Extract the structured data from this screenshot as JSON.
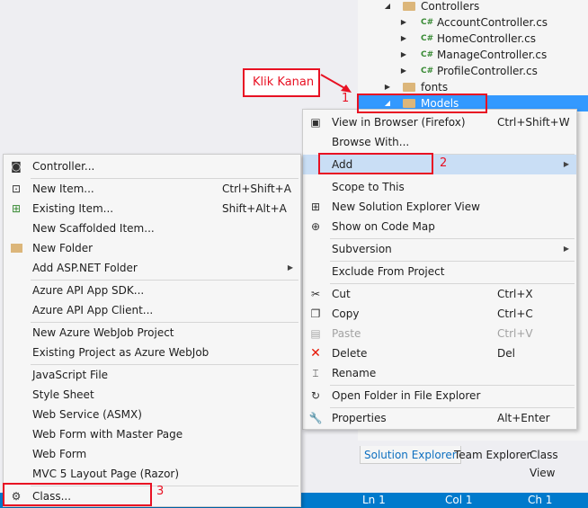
{
  "tree": {
    "items": [
      {
        "label": "Controllers",
        "kind": "folder",
        "expander": "open"
      },
      {
        "label": "AccountController.cs",
        "kind": "cs",
        "expander": "closed"
      },
      {
        "label": "HomeController.cs",
        "kind": "cs",
        "expander": "closed"
      },
      {
        "label": "ManageController.cs",
        "kind": "cs",
        "expander": "closed"
      },
      {
        "label": "ProfileController.cs",
        "kind": "cs",
        "expander": "closed"
      },
      {
        "label": "fonts",
        "kind": "folder",
        "expander": "closed"
      },
      {
        "label": "Models",
        "kind": "folder",
        "expander": "open",
        "selected": true
      }
    ],
    "cs_badge": "C#"
  },
  "context_menu": {
    "items": [
      {
        "label": "View in Browser (Firefox)",
        "shortcut": "Ctrl+Shift+W",
        "icon": "browser-icon"
      },
      {
        "label": "Browse With...",
        "shortcut": ""
      },
      {
        "label": "Add",
        "shortcut": "",
        "submenu": true,
        "highlighted": true
      },
      {
        "label": "Scope to This",
        "shortcut": ""
      },
      {
        "label": "New Solution Explorer View",
        "shortcut": "",
        "icon": "new-view-icon"
      },
      {
        "label": "Show on Code Map",
        "shortcut": "",
        "icon": "code-map-icon"
      },
      {
        "label": "Subversion",
        "shortcut": "",
        "submenu": true
      },
      {
        "label": "Exclude From Project",
        "shortcut": ""
      },
      {
        "label": "Cut",
        "shortcut": "Ctrl+X",
        "icon": "cut-icon"
      },
      {
        "label": "Copy",
        "shortcut": "Ctrl+C",
        "icon": "copy-icon"
      },
      {
        "label": "Paste",
        "shortcut": "Ctrl+V",
        "icon": "paste-icon",
        "disabled": true
      },
      {
        "label": "Delete",
        "shortcut": "Del",
        "icon": "delete-icon"
      },
      {
        "label": "Rename",
        "shortcut": "",
        "icon": "rename-icon"
      },
      {
        "label": "Open Folder in File Explorer",
        "shortcut": "",
        "icon": "open-folder-icon"
      },
      {
        "label": "Properties",
        "shortcut": "Alt+Enter",
        "icon": "wrench-icon"
      }
    ]
  },
  "add_submenu": {
    "items": [
      {
        "label": "Controller...",
        "shortcut": "",
        "icon": "controller-icon"
      },
      {
        "label": "New Item...",
        "shortcut": "Ctrl+Shift+A",
        "icon": "new-item-icon"
      },
      {
        "label": "Existing Item...",
        "shortcut": "Shift+Alt+A",
        "icon": "existing-item-icon"
      },
      {
        "label": "New Scaffolded Item...",
        "shortcut": ""
      },
      {
        "label": "New Folder",
        "shortcut": "",
        "icon": "new-folder-icon"
      },
      {
        "label": "Add ASP.NET Folder",
        "shortcut": "",
        "submenu": true
      },
      {
        "label": "Azure API App SDK...",
        "shortcut": ""
      },
      {
        "label": "Azure API App Client...",
        "shortcut": ""
      },
      {
        "label": "New Azure WebJob Project",
        "shortcut": ""
      },
      {
        "label": "Existing Project as Azure WebJob",
        "shortcut": ""
      },
      {
        "label": "JavaScript File",
        "shortcut": ""
      },
      {
        "label": "Style Sheet",
        "shortcut": ""
      },
      {
        "label": "Web Service (ASMX)",
        "shortcut": ""
      },
      {
        "label": "Web Form with Master Page",
        "shortcut": ""
      },
      {
        "label": "Web Form",
        "shortcut": ""
      },
      {
        "label": "MVC 5 Layout Page (Razor)",
        "shortcut": ""
      },
      {
        "label": "Class...",
        "shortcut": "",
        "icon": "class-icon"
      }
    ]
  },
  "tabs": [
    "Solution Explorer",
    "Team Explorer",
    "Class View"
  ],
  "status": {
    "ln": "Ln 1",
    "col": "Col 1",
    "ch": "Ch 1"
  },
  "annotations": {
    "callout": "Klik Kanan",
    "step1": "1",
    "step2": "2",
    "step3": "3"
  },
  "colors": {
    "accent": "#007acc",
    "annotation": "#e81123",
    "selection": "#3399ff",
    "highlight": "#c9def5"
  }
}
